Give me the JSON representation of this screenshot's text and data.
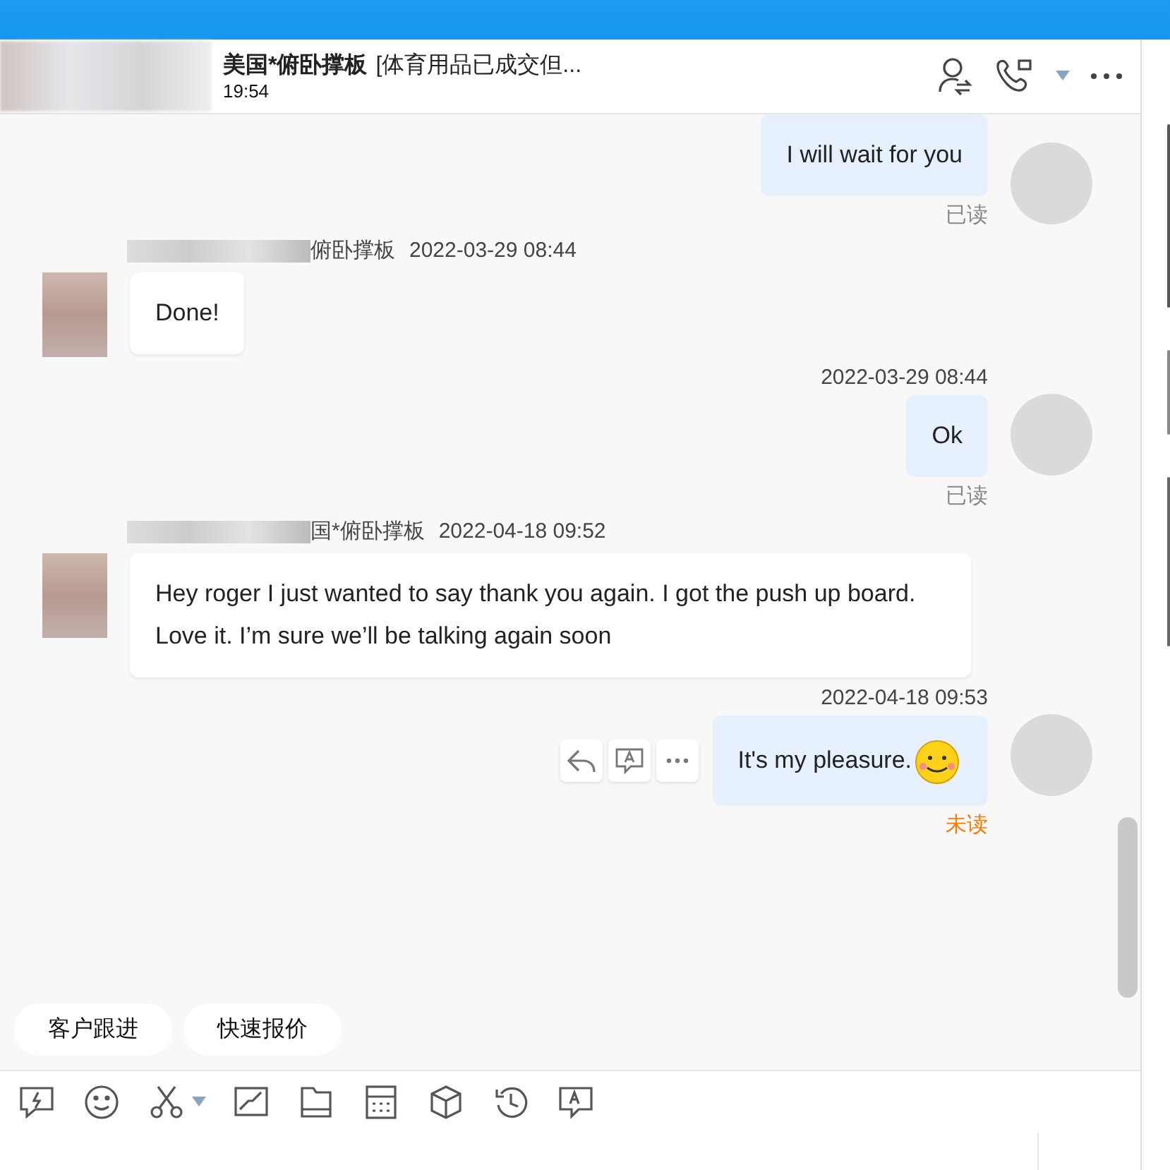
{
  "header": {
    "name": "美国*俯卧撑板",
    "tag": "[体育用品已成交但...",
    "time": "19:54"
  },
  "messages": [
    {
      "kind": "outgoing",
      "text": "I will wait for you",
      "status": "已读",
      "unread": false
    },
    {
      "kind": "incoming",
      "sender": "俯卧撑板",
      "time": "2022-03-29 08:44",
      "text": "Done!"
    },
    {
      "kind": "outgoing",
      "time": "2022-03-29 08:44",
      "text": "Ok",
      "status": "已读",
      "unread": false
    },
    {
      "kind": "incoming",
      "sender": "国*俯卧撑板",
      "time": "2022-04-18 09:52",
      "text": "Hey roger I just wanted to say thank you again. I got the push up board. Love it. I’m sure we’ll be talking again soon"
    },
    {
      "kind": "outgoing",
      "time": "2022-04-18 09:53",
      "text": "It's my pleasure.",
      "emoji": true,
      "actions": true,
      "status": "未读",
      "unread": true
    }
  ],
  "quick_replies": [
    "客户跟进",
    "快速报价"
  ]
}
